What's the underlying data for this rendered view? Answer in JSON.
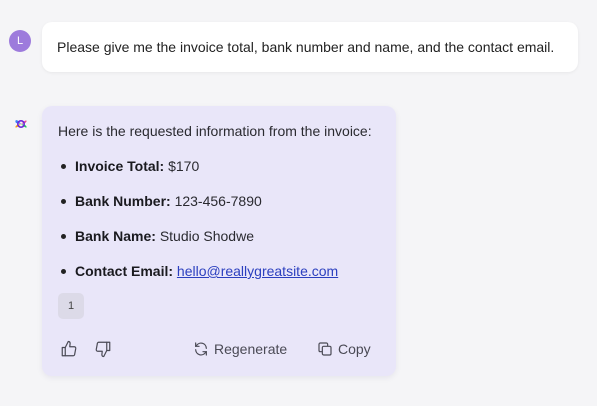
{
  "user": {
    "avatar_initial": "L",
    "message": "Please give me the invoice total, bank number and name, and the contact email."
  },
  "assistant": {
    "logo_icon": "sparkle-logo-icon",
    "intro": "Here is the requested information from the invoice:",
    "items": [
      {
        "label": "Invoice Total:",
        "value": "$170"
      },
      {
        "label": "Bank Number:",
        "value": "123-456-7890"
      },
      {
        "label": "Bank Name:",
        "value": "Studio Shodwe"
      },
      {
        "label": "Contact Email:",
        "value": "hello@reallygreatsite.com"
      }
    ],
    "citation": "1",
    "actions": {
      "thumbs_up_icon": "thumbs-up-icon",
      "thumbs_down_icon": "thumbs-down-icon",
      "regenerate_label": "Regenerate",
      "copy_label": "Copy"
    }
  },
  "colors": {
    "background": "#f5f5f7",
    "avatar": "#9d7bdc",
    "assistant_card": "#e9e6f9",
    "link": "#2b3fbf"
  }
}
